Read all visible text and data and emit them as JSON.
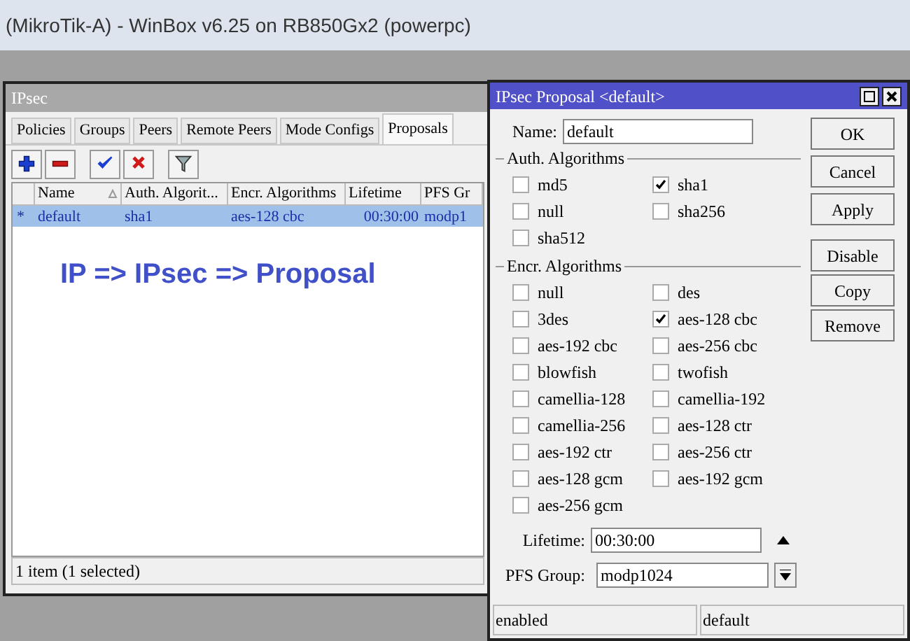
{
  "app_title": "(MikroTik-A) - WinBox v6.25 on RB850Gx2 (powerpc)",
  "ipsec_window": {
    "title": "IPsec",
    "tabs": [
      {
        "label": "Policies",
        "selected": false
      },
      {
        "label": "Groups",
        "selected": false
      },
      {
        "label": "Peers",
        "selected": false
      },
      {
        "label": "Remote Peers",
        "selected": false
      },
      {
        "label": "Mode Configs",
        "selected": false
      },
      {
        "label": "Proposals",
        "selected": true
      }
    ],
    "toolbar": [
      {
        "kind": "add"
      },
      {
        "kind": "remove"
      },
      {
        "kind": "enable"
      },
      {
        "kind": "disable"
      },
      {
        "kind": "filter"
      }
    ],
    "table": {
      "columns": [
        "Name",
        "Auth. Algorit...",
        "Encr. Algorithms",
        "Lifetime",
        "PFS Gr"
      ],
      "rows": [
        {
          "marker": "*",
          "cells": [
            "default",
            "sha1",
            "aes-128 cbc",
            "00:30:00",
            "modp1"
          ],
          "selected": true
        }
      ]
    },
    "annotation": "IP => IPsec => Proposal",
    "status": "1 item (1 selected)"
  },
  "dialog": {
    "title": "IPsec Proposal <default>",
    "name_label": "Name:",
    "name_value": "default",
    "auth_section": "Auth. Algorithms",
    "auth_options": [
      {
        "label": "md5",
        "checked": false
      },
      {
        "label": "sha1",
        "checked": true
      },
      {
        "label": "null",
        "checked": false
      },
      {
        "label": "sha256",
        "checked": false
      },
      {
        "label": "sha512",
        "checked": false
      }
    ],
    "encr_section": "Encr. Algorithms",
    "encr_options": [
      {
        "label": "null",
        "checked": false
      },
      {
        "label": "des",
        "checked": false
      },
      {
        "label": "3des",
        "checked": false
      },
      {
        "label": "aes-128 cbc",
        "checked": true
      },
      {
        "label": "aes-192 cbc",
        "checked": false
      },
      {
        "label": "aes-256 cbc",
        "checked": false
      },
      {
        "label": "blowfish",
        "checked": false
      },
      {
        "label": "twofish",
        "checked": false
      },
      {
        "label": "camellia-128",
        "checked": false
      },
      {
        "label": "camellia-192",
        "checked": false
      },
      {
        "label": "camellia-256",
        "checked": false
      },
      {
        "label": "aes-128 ctr",
        "checked": false
      },
      {
        "label": "aes-192 ctr",
        "checked": false
      },
      {
        "label": "aes-256 ctr",
        "checked": false
      },
      {
        "label": "aes-128 gcm",
        "checked": false
      },
      {
        "label": "aes-192 gcm",
        "checked": false
      },
      {
        "label": "aes-256 gcm",
        "checked": false
      }
    ],
    "lifetime_label": "Lifetime:",
    "lifetime_value": "00:30:00",
    "pfs_label": "PFS Group:",
    "pfs_value": "modp1024",
    "buttons": [
      "OK",
      "Cancel",
      "Apply",
      "Disable",
      "Copy",
      "Remove"
    ],
    "status": [
      "enabled",
      "default"
    ]
  }
}
